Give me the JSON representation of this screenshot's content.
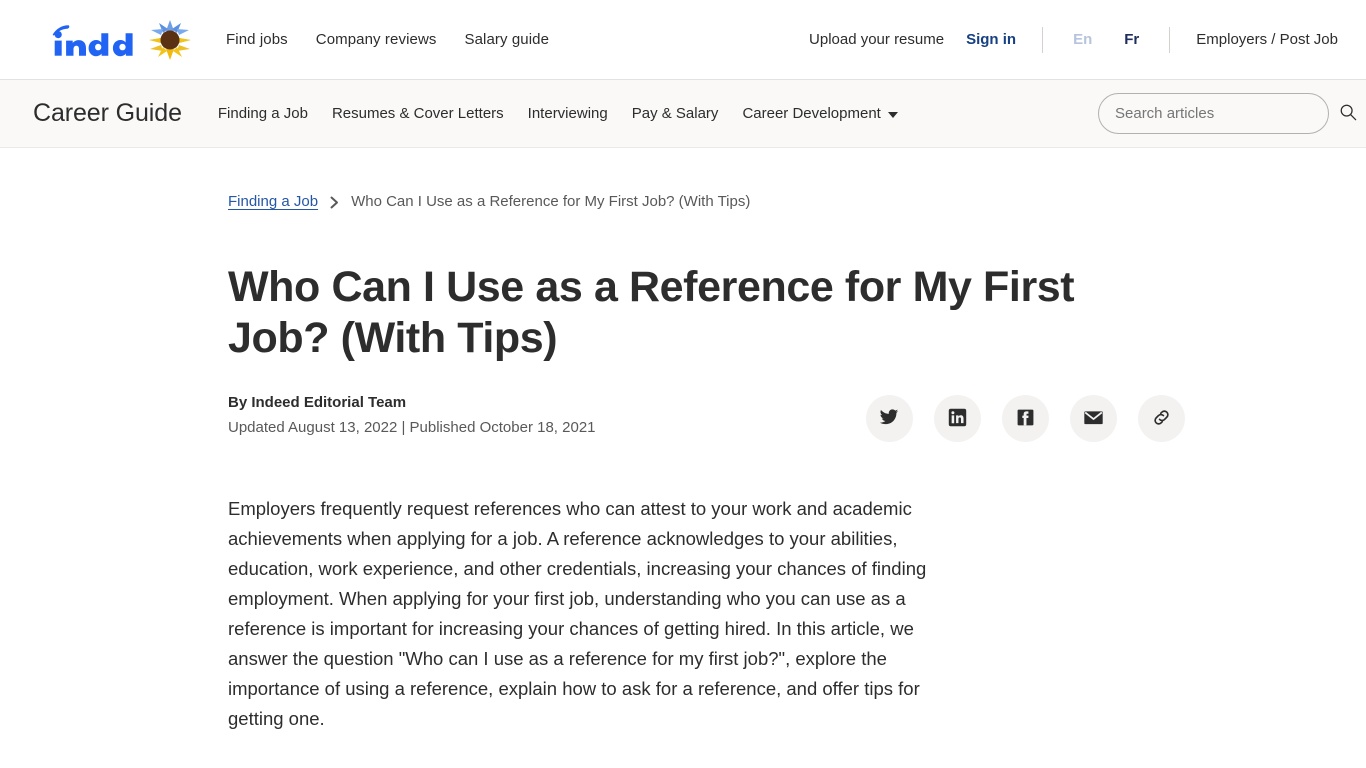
{
  "global_nav": {
    "logo_text": "indeed",
    "logo_icon": "indeed-wordmark",
    "sunflower_icon": "sunflower-icon",
    "links": [
      {
        "label": "Find jobs",
        "name": "find-jobs"
      },
      {
        "label": "Company reviews",
        "name": "company-reviews"
      },
      {
        "label": "Salary guide",
        "name": "salary-guide"
      }
    ],
    "upload_resume": "Upload your resume",
    "sign_in": "Sign in",
    "lang_en": "En",
    "lang_fr": "Fr",
    "employers": "Employers / Post Job"
  },
  "career_guide_nav": {
    "title": "Career Guide",
    "links": [
      {
        "label": "Finding a Job",
        "name": "finding-a-job"
      },
      {
        "label": "Resumes & Cover Letters",
        "name": "resumes-cover-letters"
      },
      {
        "label": "Interviewing",
        "name": "interviewing"
      },
      {
        "label": "Pay & Salary",
        "name": "pay-salary"
      },
      {
        "label": "Career Development",
        "name": "career-development",
        "has_dropdown": true
      }
    ],
    "search_placeholder": "Search articles",
    "search_value": "",
    "search_icon": "search-icon"
  },
  "breadcrumb": {
    "parent": "Finding a Job",
    "separator": "chevron-right-icon",
    "current": "Who Can I Use as a Reference for My First Job? (With Tips)"
  },
  "article": {
    "title": "Who Can I Use as a Reference for My First Job? (With Tips)",
    "byline": "By Indeed Editorial Team",
    "dates": "Updated August 13, 2022 | Published October 18, 2021",
    "body_paragraph": "Employers frequently request references who can attest to your work and academic achievements when applying for a job. A reference acknowledges to your abilities, education, work experience, and other credentials, increasing your chances of finding employment. When applying for your first job, understanding who you can use as a reference is important for increasing your chances of getting hired. In this article, we answer the question \"Who can I use as a reference for my first job?\", explore the importance of using a reference, explain how to ask for a reference, and offer tips for getting one."
  },
  "share": {
    "buttons": [
      {
        "name": "share-twitter-button",
        "icon": "twitter-icon"
      },
      {
        "name": "share-linkedin-button",
        "icon": "linkedin-icon"
      },
      {
        "name": "share-facebook-button",
        "icon": "facebook-icon"
      },
      {
        "name": "share-email-button",
        "icon": "email-icon"
      },
      {
        "name": "share-link-button",
        "icon": "link-icon"
      }
    ]
  },
  "colors": {
    "indeed_blue": "#2557a7",
    "sign_in_blue": "#164081",
    "lang_active": "#1f2d5c",
    "lang_inactive": "#b6c4dd",
    "text_primary": "#2d2d2d",
    "text_secondary": "#595959",
    "subnav_bg": "#faf9f8",
    "share_bg": "#f3f2f1",
    "sunflower_blue": "#6e9ee8",
    "sunflower_yellow": "#f3c315",
    "sunflower_center": "#5a3213"
  }
}
